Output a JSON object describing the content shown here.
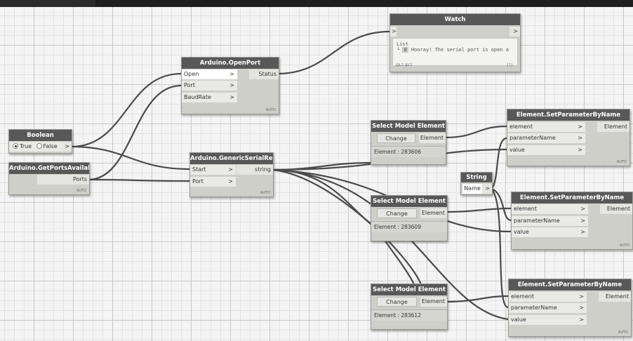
{
  "nodes": {
    "boolean": {
      "title": "Boolean",
      "true_label": "True",
      "false_label": "False",
      "selected": "True",
      "out": ">"
    },
    "ports_available": {
      "title": "Arduino.GetPortsAvailable",
      "out": "Ports",
      "auto": "AUTO"
    },
    "open_port": {
      "title": "Arduino.OpenPort",
      "inputs": [
        "Open",
        "Port",
        "BaudRate"
      ],
      "out": "Status",
      "auto": "AUTO"
    },
    "serial_read": {
      "title": "Arduino.GenericSerialRead",
      "inputs": [
        "Start",
        "Port"
      ],
      "out": "string",
      "auto": "AUTO"
    },
    "watch": {
      "title": "Watch",
      "in": ">",
      "out": ">",
      "list_label": "List",
      "item_index": "0",
      "item_text": "Hooray! The serial port is open a",
      "levels": "@L2 @L1",
      "count": "{1}"
    },
    "select1": {
      "title": "Select Model Element",
      "button": "Change",
      "out": "Element",
      "status": "Element : 283606"
    },
    "select2": {
      "title": "Select Model Element",
      "button": "Change",
      "out": "Element",
      "status": "Element : 283609"
    },
    "select3": {
      "title": "Select Model Element",
      "button": "Change",
      "out": "Element",
      "status": "Element : 283612"
    },
    "string": {
      "title": "String",
      "value": "Name",
      "out": ">"
    },
    "setparam1": {
      "title": "Element.SetParameterByName",
      "inputs": [
        "element",
        "parameterName",
        "value"
      ],
      "out": "Element",
      "auto": "AUTO"
    },
    "setparam2": {
      "title": "Element.SetParameterByName",
      "inputs": [
        "element",
        "parameterName",
        "value"
      ],
      "out": "Element",
      "auto": "AUTO"
    },
    "setparam3": {
      "title": "Element.SetParameterByName",
      "inputs": [
        "element",
        "parameterName",
        "value"
      ],
      "out": "Element",
      "auto": "AUTO"
    }
  },
  "arrow_glyph": ">",
  "colors": {
    "header": "#585858",
    "node_body": "#cfcfca",
    "wire": "#4a4a4a",
    "canvas": "#f4f4f4"
  }
}
